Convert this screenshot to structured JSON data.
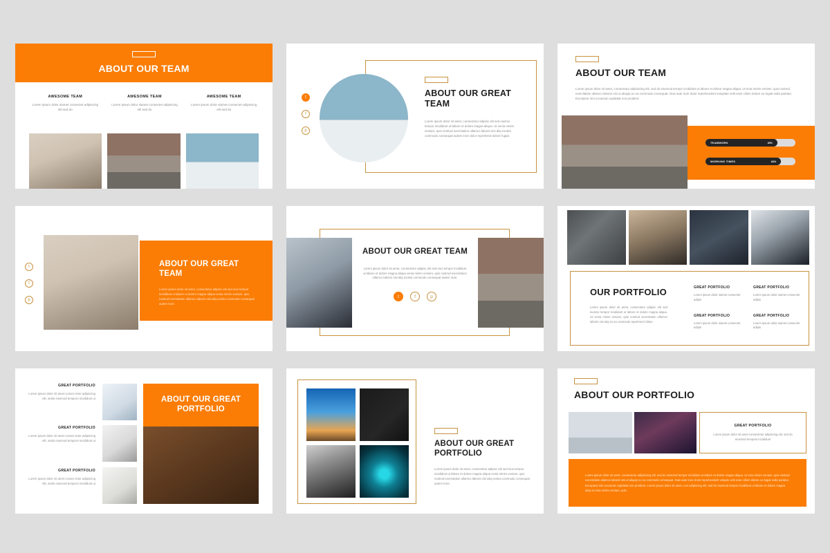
{
  "theme": {
    "orange": "#FB7D05",
    "gold": "#C8913F",
    "dark": "#1D1D1D",
    "body_gray": "#8B8B8B",
    "page_bg": "#DEDEDE",
    "slide_bg": "#FFFFFF"
  },
  "lorem": {
    "short": "Lorem ipsum dolor siamet consectet adipiscing elit sed do",
    "mid": "Lorem ipsum dolor sit amet, consectetur adipisc elit sed eius tempor incididunt ut labore et dolore magna aliqua venia minim veniam, quis nostrud exercitation ullamco laboris nisi aliq exolea commodo consequat autem irure.",
    "long": "Lorem ipsum dolor sit amet, consectetur adipisicing elit, sed do eiusmod tempor incididunt ut labore et dolore magna aliqua. Ut enia minim veniam, quis nostrud exercitation ullamco laboris nisi ut aliquip ex ea commodo consequat. Duis aute irure dolor reprehenderit voluptate velit esse cillum dolore eu fugiat nulla pariatur. Excepteur sint occaecat cupidatat non proident.",
    "circle": "Lorem ipsum dolor sit amet, consectetur adipisc elit sed eiusmo tempor incididunt ut labore et dolore magna aliqua. Ut venia minim veniam, quis nostrud exercitation ullamco laboris nisi aliq exolea commodo consequat autem irure dolor reprehend dolore fugiat.",
    "portfolio_left": "Lorem ipsum dolor sit amet, consectetur adipisc elit sed eiusmo tempor incididunt ut labore et dolore magna aliqua. Ut venia minim veniam, quis nostrud exercitation ullamco laboris nisi aliq ex ea commodo reprehend cillum.",
    "portfolio_cell": "Lorem ipsum dolor siamet consectet adipis",
    "portfolio_row": "Lorem ipsum dolor sit amet consec tetur adipiscing elit, sedoi eiusmod temporA incididunt ut",
    "card_note": "Lorem ipsum dolor sit amet consectetur adipiscing elit, sed do eiusmod tempora incididunt",
    "banner": "Lorem ipsum dolor sit amet, consectetur adipisicing elit, sed do eiusmod tempor incididunt ut labore et dolore magna aliqua. Ut enia minim veniam, quis nostrud exercitation ullamco laboris nisi ut aliquip ex ea commodo consequat. Duis aute irure dolor reprehenderit volupte velit esse cillum dolore eu fugiat nulla pariatur. Excepteur sint occaecat cupidatat non proident. Lorem ipsum dolor sit amet, con adipiscing elit, sed do eiusmod tempor incididunt ut labore et dolore magna aliqu ut enia minim veniam, quis."
  },
  "social": {
    "twitter": "twitter-icon",
    "facebook": "facebook-icon",
    "pinterest": "pinterest-icon",
    "twitter_glyph": "t",
    "facebook_glyph": "f",
    "pinterest_glyph": "p"
  },
  "slides": [
    {
      "id": "slide-1-about-our-team-orange-header",
      "title": "ABOUT OUR TEAM",
      "columns": [
        {
          "heading": "AWESOME TEAM",
          "text": "Lorem ipsum dolor siamet consectet adipiscing elit sed do"
        },
        {
          "heading": "AWESOME TEAM",
          "text": "Lorem ipsum dolor siamet consectet adipiscing elit sed do"
        },
        {
          "heading": "AWESOME TEAM",
          "text": "Lorem ipsum dolor siamet consectet adipiscing elit sed do"
        }
      ]
    },
    {
      "id": "slide-2-about-our-great-team-circle",
      "title": "ABOUT OUR GREAT TEAM",
      "body": "Lorem ipsum dolor sit amet, consectetur adipisc elit sed eiusmo tempor incididunt ut labore et dolore magna aliqua. Ut venia minim veniam, quis nostrud exercitation ullamco laboris nisi aliq exolea commodo consequat autem irure dolor reprehend dolore fugiat."
    },
    {
      "id": "slide-3-about-our-team-skills",
      "title": "ABOUT OUR TEAM",
      "body": "Lorem ipsum dolor sit amet, consectetur adipisicing elit, sed do eiusmod tempor incididunt ut labore et dolore magna aliqua. Ut enia minim veniam, quis nostrud exercitation ullamco laboris nisi ut aliquip ex ea commodo consequat. Duis aute irure dolor reprehenderit voluptate velit esse cillum dolore eu fugiat nulla pariatur. Excepteur sint occaecat cupidatat non proident.",
      "skills": [
        {
          "label": "TEAMWORK",
          "value": "80%",
          "pct": 80
        },
        {
          "label": "WORKING TIMES",
          "value": "84%",
          "pct": 84
        }
      ]
    },
    {
      "id": "slide-4-about-our-great-team-orange-panel",
      "title": "ABOUT OUR GREAT TEAM",
      "body": "Lorem ipsum dolor sit amet, consectetur adipisc elit sed eius tempor incididunt ut labore et dolore magna aliqua venia minim veniam, quis nostrud exercitation ullamco laboris nisi aliq exolea commodo consequat autem irure."
    },
    {
      "id": "slide-5-about-our-great-team-centered",
      "title": "ABOUT OUR GREAT TEAM",
      "body": "Lorem ipsum dolor sit amet, consectetur adipisc elit sed eius tempor incididunt ut labore et dolore magna aliqua venia minim veniam, quis nostrud exercitation ullamco laboris nisi aliq exolea commodo consequat autem irure."
    },
    {
      "id": "slide-6-our-portfolio-grid",
      "title": "OUR PORTFOLIO",
      "body": "Lorem ipsum dolor sit amet, consectetur adipisc elit sed eiusmo tempor incididunt ut labore et dolore magna aliqua. Ut venia minim veniam, quis nostrud exercitation ullamco laboris nisi aliq ex ea commodo reprehend cillum.",
      "cells": [
        {
          "heading": "GREAT PORTFOLIO",
          "text": "Lorem ipsum dolor siamet consectet adipis"
        },
        {
          "heading": "GREAT PORTFOLIO",
          "text": "Lorem ipsum dolor siamet consectet adipis"
        },
        {
          "heading": "GREAT PORTFOLIO",
          "text": "Lorem ipsum dolor siamet consectet adipis"
        },
        {
          "heading": "GREAT PORTFOLIO",
          "text": "Lorem ipsum dolor siamet consectet adipis"
        }
      ]
    },
    {
      "id": "slide-7-about-our-great-portfolio-list",
      "title": "ABOUT OUR GREAT PORTFOLIO",
      "rows": [
        {
          "heading": "GREAT PORTFOLIO",
          "text": "Lorem ipsum dolor sit amet consec tetur adipiscing elit, sedoi eiusmod temporA incididunt ut"
        },
        {
          "heading": "GREAT PORTFOLIO",
          "text": "Lorem ipsum dolor sit amet consec tetur adipiscing elit, sedoi eiusmod temporA incididunt ut"
        },
        {
          "heading": "GREAT PORTFOLIO",
          "text": "Lorem ipsum dolor sit amet consec tetur adipiscing elit, sedoi eiusmod temporA incididunt ut"
        }
      ]
    },
    {
      "id": "slide-8-about-our-great-portfolio-quad",
      "title": "ABOUT OUR GREAT PORTFOLIO",
      "body": "Lorem ipsum dolor sit amet, consectetur adipisc elit sed eius tempor incididunt ut labore et dolore magna aliqua venia minim veniam, quis nostrud exercitation ullamco laboris nisi aliq exolea commodo consequat autem irure."
    },
    {
      "id": "slide-9-about-our-portfolio-banner",
      "title": "ABOUT OUR PORTFOLIO",
      "card": {
        "heading": "GREAT PORTFOLIO",
        "text": "Lorem ipsum dolor sit amet consectetur adipiscing elit, sed do eiusmod tempora incididunt"
      },
      "banner": "Lorem ipsum dolor sit amet, consectetur adipisicing elit, sed do eiusmod tempor incididunt ut labore et dolore magna aliqua. Ut enia minim veniam, quis nostrud exercitation ullamco laboris nisi ut aliquip ex ea commodo consequat. Duis aute irure dolor reprehenderit volupte velit esse cillum dolore eu fugiat nulla pariatur. Excepteur sint occaecat cupidatat non proident. Lorem ipsum dolor sit amet, con adipiscing elit, sed do eiusmod tempor incididunt ut labore et dolore magna aliqu ut enia minim veniam, quis."
    }
  ]
}
